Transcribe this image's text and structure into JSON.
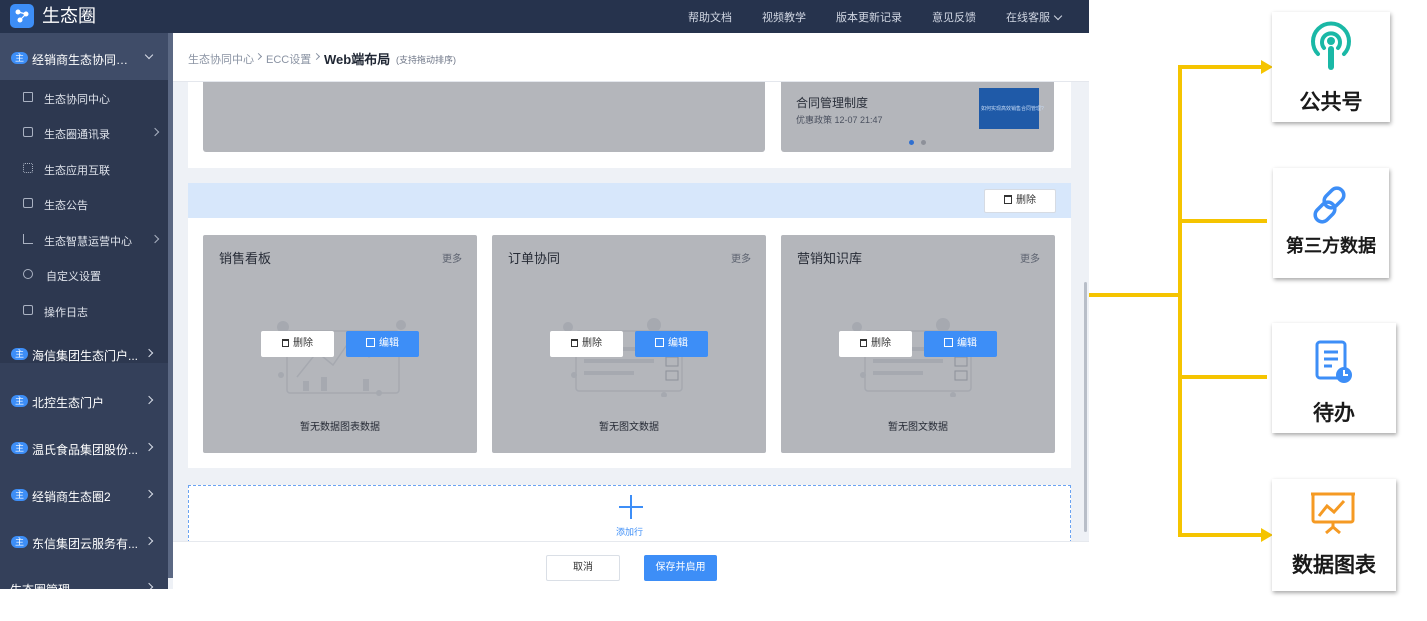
{
  "app": {
    "brand": "生态圈",
    "top_nav": [
      "帮助文档",
      "视频教学",
      "版本更新记录",
      "意见反馈",
      "在线客服"
    ]
  },
  "sidebar": {
    "tag": "主",
    "active_group": "经销商生态协同平台",
    "sub_items": [
      "生态协同中心",
      "生态圈通讯录",
      "生态应用互联",
      "生态公告",
      "生态智慧运营中心",
      "自定义设置",
      "操作日志"
    ],
    "groups": [
      "海信集团生态门户...",
      "北控生态门户",
      "温氏食品集团股份...",
      "经销商生态圈2",
      "东信集团云服务有..."
    ],
    "bottom_item": "生态圈管理"
  },
  "breadcrumb": {
    "level1": "生态协同中心",
    "level2": "ECC设置",
    "current": "Web端布局",
    "hint": "(支持拖动排序)"
  },
  "top_row": {
    "news_title": "合同管理制度",
    "news_meta": "优惠政策 12-07 21:47",
    "thumb_text": "如何实现高效销售合同管理?"
  },
  "row_delete_label": "删除",
  "cards": [
    {
      "title": "销售看板",
      "more": "更多",
      "delete": "删除",
      "edit": "编辑",
      "empty_text": "暂无数据图表数据"
    },
    {
      "title": "订单协同",
      "more": "更多",
      "delete": "删除",
      "edit": "编辑",
      "empty_text": "暂无图文数据"
    },
    {
      "title": "营销知识库",
      "more": "更多",
      "delete": "删除",
      "edit": "编辑",
      "empty_text": "暂无图文数据"
    }
  ],
  "add_row_label": "添加行",
  "footer": {
    "cancel": "取消",
    "save": "保存并启用"
  },
  "annotation_cards": [
    "公共号",
    "第三方数据",
    "待办",
    "数据图表"
  ],
  "colors": {
    "accent": "#3d8ef7",
    "connector": "#f5c400",
    "sidebar": "#34405a",
    "topbar": "#26334d"
  }
}
